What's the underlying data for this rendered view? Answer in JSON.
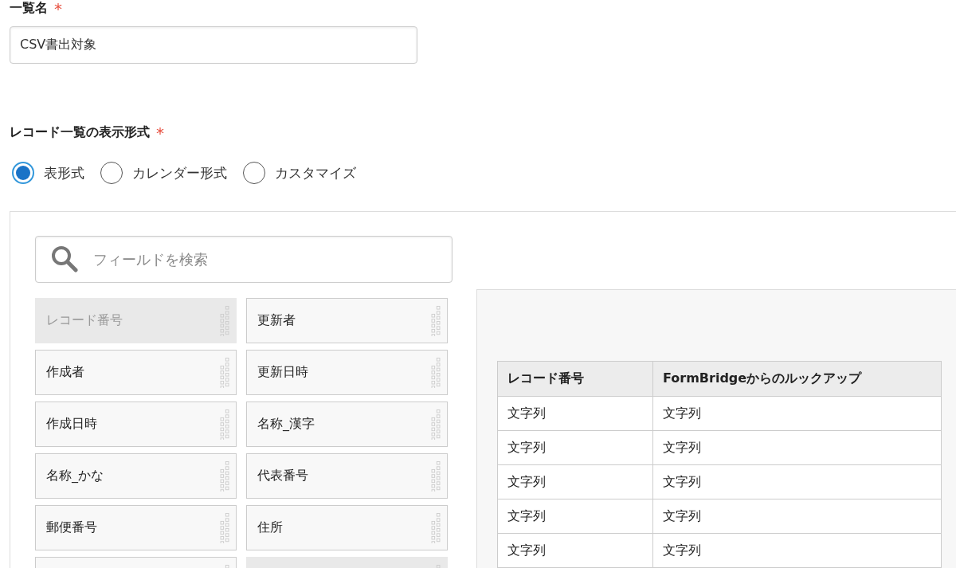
{
  "list_name": {
    "label": "一覧名",
    "required_mark": "*",
    "value": "CSV書出対象"
  },
  "display_format": {
    "label": "レコード一覧の表示形式",
    "required_mark": "*",
    "options": [
      {
        "label": "表形式",
        "selected": true
      },
      {
        "label": "カレンダー形式",
        "selected": false
      },
      {
        "label": "カスタマイズ",
        "selected": false
      }
    ]
  },
  "field_search": {
    "placeholder": "フィールドを検索"
  },
  "fields": [
    {
      "label": "レコード番号",
      "used": true
    },
    {
      "label": "更新者",
      "used": false
    },
    {
      "label": "作成者",
      "used": false
    },
    {
      "label": "更新日時",
      "used": false
    },
    {
      "label": "作成日時",
      "used": false
    },
    {
      "label": "名称_漢字",
      "used": false
    },
    {
      "label": "名称_かな",
      "used": false
    },
    {
      "label": "代表番号",
      "used": false
    },
    {
      "label": "郵便番号",
      "used": false
    },
    {
      "label": "住所",
      "used": false
    },
    {
      "used": false
    },
    {
      "used": true
    }
  ],
  "preview_table": {
    "columns": [
      "レコード番号",
      "FormBridgeからのルックアップ"
    ],
    "rows": [
      [
        "文字列",
        "文字列"
      ],
      [
        "文字列",
        "文字列"
      ],
      [
        "文字列",
        "文字列"
      ],
      [
        "文字列",
        "文字列"
      ],
      [
        "文字列",
        "文字列"
      ]
    ]
  }
}
